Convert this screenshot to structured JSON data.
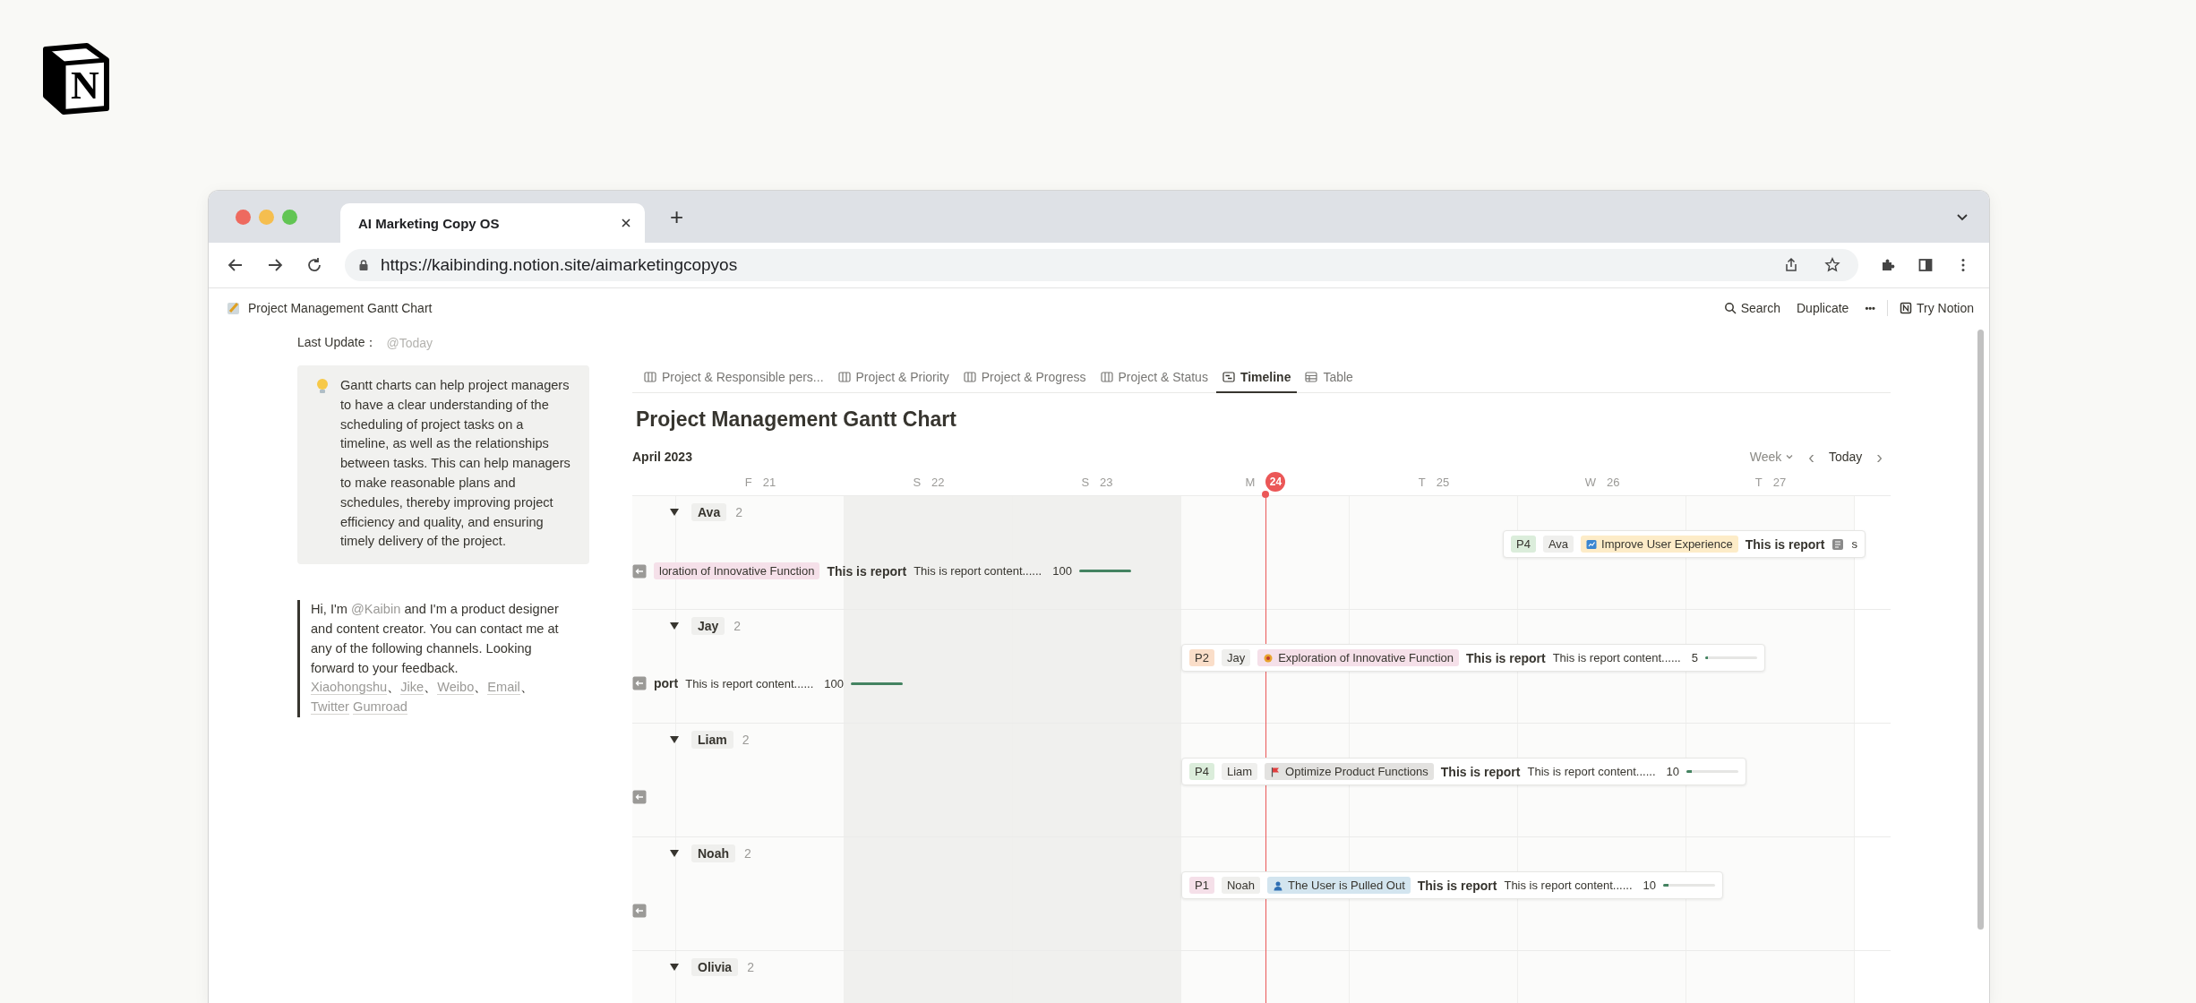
{
  "logo": {
    "letter": "N"
  },
  "browser": {
    "tab_title": "AI Marketing Copy OS",
    "new_tab": "+",
    "url": "https://kaibinding.notion.site/aimarketingcopyos"
  },
  "topbar": {
    "breadcrumb": "Project Management Gantt Chart",
    "search": "Search",
    "duplicate": "Duplicate",
    "more": "•••",
    "try": "Try Notion"
  },
  "sidebar": {
    "last_update_label": "Last Update：",
    "last_update_value": "@Today",
    "callout": "Gantt charts can help project managers to have a clear understanding of the scheduling of project tasks on a timeline, as well as the relationships between tasks. This can help managers to make reasonable plans and schedules, thereby improving project efficiency and quality, and ensuring timely delivery of the project.",
    "quote_before": "Hi, I'm ",
    "mention": "@Kaibin",
    "quote_after": " and I'm a product designer and content creator. You can contact me at any of the following channels. Looking forward to your feedback.",
    "links": [
      {
        "label": "Xiaohongshu",
        "separator": "、"
      },
      {
        "label": "Jike",
        "separator": "、"
      },
      {
        "label": "Weibo",
        "separator": "、"
      },
      {
        "label": "Email",
        "separator": "、"
      },
      {
        "label": "Twitter"
      },
      {
        "label": "Gumroad"
      }
    ]
  },
  "views": [
    {
      "label": "Project & Responsible pers...",
      "kind": "board",
      "selected": false
    },
    {
      "label": "Project & Priority",
      "kind": "board",
      "selected": false
    },
    {
      "label": "Project & Progress",
      "kind": "board",
      "selected": false
    },
    {
      "label": "Project & Status",
      "kind": "board",
      "selected": false
    },
    {
      "label": "Timeline",
      "kind": "timeline",
      "selected": true
    },
    {
      "label": "Table",
      "kind": "table",
      "selected": false
    }
  ],
  "title": "Project Management Gantt Chart",
  "timeline": {
    "month": "April 2023",
    "scale": "Week",
    "today": "Today",
    "prev": "‹",
    "next": "›",
    "days": [
      {
        "weekday": "F",
        "date": "21",
        "today": false,
        "weekend": false
      },
      {
        "weekday": "S",
        "date": "22",
        "today": false,
        "weekend": true
      },
      {
        "weekday": "S",
        "date": "23",
        "today": false,
        "weekend": true
      },
      {
        "weekday": "M",
        "date": "24",
        "today": true,
        "weekend": false
      },
      {
        "weekday": "T",
        "date": "25",
        "today": false,
        "weekend": false
      },
      {
        "weekday": "W",
        "date": "26",
        "today": false,
        "weekend": false
      },
      {
        "weekday": "T",
        "date": "27",
        "today": false,
        "weekend": false
      }
    ]
  },
  "groups": [
    {
      "name": "Ava",
      "count": "2",
      "expanded": true,
      "items": [
        {
          "kind": "card",
          "priority": {
            "label": "P4",
            "color": "#dbeddb"
          },
          "person": "Ava",
          "project": {
            "label": "Improve User Experience",
            "color": "#fdecc8"
          },
          "title": "This is report",
          "content_icon": true,
          "content": "s"
        },
        {
          "kind": "overflow",
          "project": {
            "label": "loration of Innovative Function",
            "color": "#f5e0e9"
          },
          "title": "This is report",
          "content": "This is report content......",
          "progress": "100",
          "level": 1
        }
      ]
    },
    {
      "name": "Jay",
      "count": "2",
      "expanded": true,
      "items": [
        {
          "kind": "card",
          "priority": {
            "label": "P2",
            "color": "#fadec9"
          },
          "person": "Jay",
          "project": {
            "label": "Exploration of Innovative Function",
            "color": "#f5e0e9"
          },
          "title": "This is report",
          "content_icon": false,
          "content": "This is report content......",
          "progress": "5",
          "level": 0.05
        },
        {
          "kind": "overflow",
          "title": "port",
          "content": "This is report content......",
          "progress": "100",
          "level": 1
        }
      ]
    },
    {
      "name": "Liam",
      "count": "2",
      "expanded": true,
      "items": [
        {
          "kind": "card",
          "priority": {
            "label": "P4",
            "color": "#dbeddb"
          },
          "person": "Liam",
          "project": {
            "label": "Optimize Product Functions",
            "color": "#e3e2e0"
          },
          "title": "This is report",
          "content_icon": false,
          "content": "This is report content......",
          "progress": "10",
          "level": 0.1
        },
        {
          "kind": "overflow"
        }
      ]
    },
    {
      "name": "Noah",
      "count": "2",
      "expanded": true,
      "items": [
        {
          "kind": "card",
          "priority": {
            "label": "P1",
            "color": "#f5e0e9"
          },
          "person": "Noah",
          "project": {
            "label": "The User is Pulled Out",
            "color": "#d3e5ef"
          },
          "title": "This is report",
          "content_icon": false,
          "content": "This is report content......",
          "progress": "10",
          "level": 0.1
        },
        {
          "kind": "overflow"
        }
      ]
    },
    {
      "name": "Olivia",
      "count": "2",
      "expanded": true,
      "items": [
        {
          "kind": "edge"
        }
      ]
    }
  ]
}
